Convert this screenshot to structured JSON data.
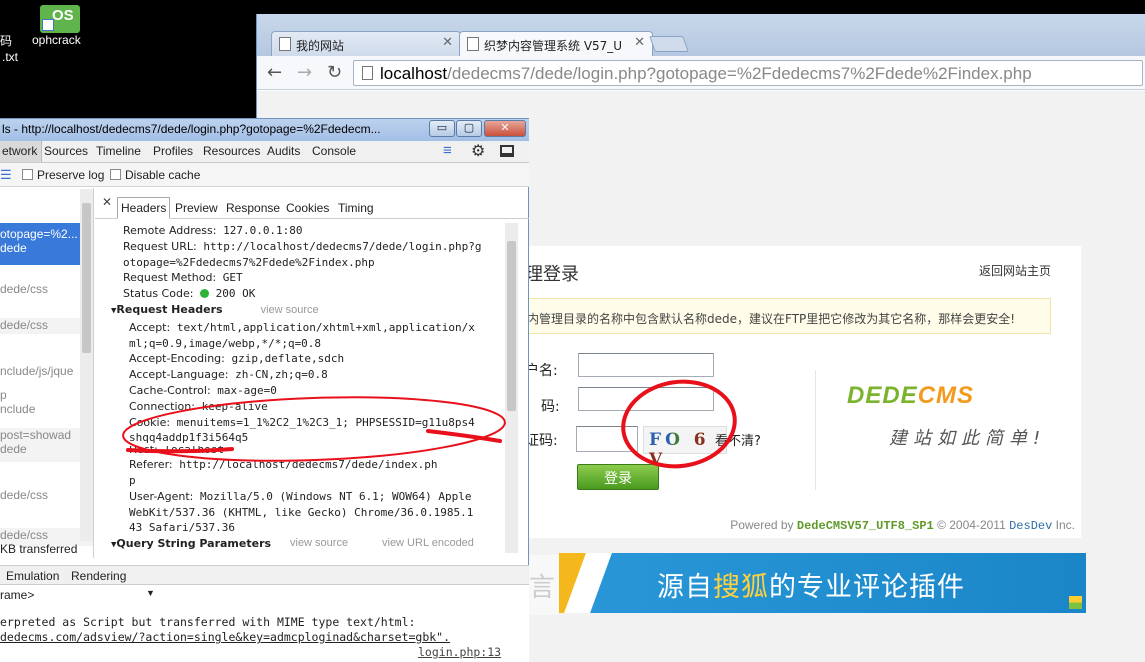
{
  "desktop": {
    "partial_label_1": "码",
    "partial_label_2": ".txt",
    "app_label": "ophcrack",
    "app_icon_text": "OS"
  },
  "browser": {
    "tabs": [
      {
        "label": "我的网站"
      },
      {
        "label": "织梦内容管理系统 V57_U"
      }
    ],
    "url_host": "localhost",
    "url_path": "/dedecms7/dede/login.php?gotopage=%2Fdedecms7%2Fdede%2Findex.php"
  },
  "login_page": {
    "title": "理登录",
    "back_link": "返回网站主页",
    "notice": "内管理目录的名称中包含默认名称dede，建议在FTP里把它修改为其它名称，那样会更安全!",
    "username_label": "户名:",
    "password_label": "码:",
    "captcha_label": "证码:",
    "captcha_text": "FO 6 V",
    "captcha_hint": "看不清?",
    "login_button": "登录",
    "brand_a": "DEDE",
    "brand_b": "CMS",
    "slogan": "建站如此简单!",
    "powered_prefix": "Powered by",
    "powered_version": "DedeCMSV57_UTF8_SP1",
    "powered_copy": "© 2004-2011",
    "powered_company": "DesDev",
    "powered_inc": "Inc.",
    "left_glyph": "言"
  },
  "banner": {
    "text_a": "源自",
    "text_hl": "搜狐",
    "text_b": "的专业评论插件"
  },
  "devtools": {
    "title": "ls - http://localhost/dedecms7/dede/login.php?gotopage=%2Fdedecm...",
    "min_btn": "▭",
    "max_btn": "▢",
    "close_btn": "✕",
    "tabs": [
      "etwork",
      "Sources",
      "Timeline",
      "Profiles",
      "Resources",
      "Audits",
      "Console"
    ],
    "preserve_log": "Preserve log",
    "disable_cache": "Disable cache",
    "requests": [
      "otopage=%2...",
      "dede",
      "dede/css",
      "dede/css",
      "nclude/js/jque",
      "p",
      "nclude",
      "post=showad",
      "dede",
      "dede/css",
      "dede/css"
    ],
    "transfer_status": "KB transferred",
    "detail_tabs": [
      "Headers",
      "Preview",
      "Response",
      "Cookies",
      "Timing"
    ],
    "headers": {
      "remote_address_key": "Remote Address:",
      "remote_address": "127.0.0.1:80",
      "request_url_key": "Request URL:",
      "request_url_1": "http://localhost/dedecms7/dede/login.php?g",
      "request_url_2": "otopage=%2Fdedecms7%2Fdede%2Findex.php",
      "method_key": "Request Method:",
      "method": "GET",
      "status_key": "Status Code:",
      "status": "200 OK",
      "req_headers_title": "Request Headers",
      "view_source": "view source",
      "accept_key": "Accept:",
      "accept_1": "text/html,application/xhtml+xml,application/x",
      "accept_2": "ml;q=0.9,image/webp,*/*;q=0.8",
      "accept_enc_key": "Accept-Encoding:",
      "accept_enc": "gzip,deflate,sdch",
      "accept_lang_key": "Accept-Language:",
      "accept_lang": "zh-CN,zh;q=0.8",
      "cache_key": "Cache-Control:",
      "cache": "max-age=0",
      "conn_key": "Connection:",
      "conn": "keep-alive",
      "cookie_key": "Cookie:",
      "cookie_1": "menuitems=1_1%2C2_1%2C3_1; PHPSESSID=g11u8ps4",
      "cookie_2": "shqq4addp1f3i564q5",
      "host_key": "Host:",
      "host": "localhost",
      "referer_key": "Referer:",
      "referer_1": "http://localhost/dedecms7/dede/index.ph",
      "referer_2": "p",
      "ua_key": "User-Agent:",
      "ua_1": "Mozilla/5.0 (Windows NT 6.1; WOW64) Apple",
      "ua_2": "WebKit/537.36 (KHTML, like Gecko) Chrome/36.0.1985.1",
      "ua_3": "43 Safari/537.36",
      "query_title": "Query String Parameters",
      "view_source_2": "view source",
      "view_url_encoded": "view URL encoded"
    },
    "bottom_tabs": [
      "Emulation",
      "Rendering"
    ],
    "frame_select": "rame>",
    "console_line_1": "erpreted as Script but transferred with MIME type text/html:",
    "console_line_2": "dedecms.com/adsview/?action=single&key=admcploginad&charset=gbk\".",
    "console_source": "login.php:13"
  },
  "colors": {
    "annotation_red": "#e8101a",
    "selected_request": "#3879d9",
    "login_green": "#5aa82a",
    "banner_blue": "#2a98d8"
  }
}
